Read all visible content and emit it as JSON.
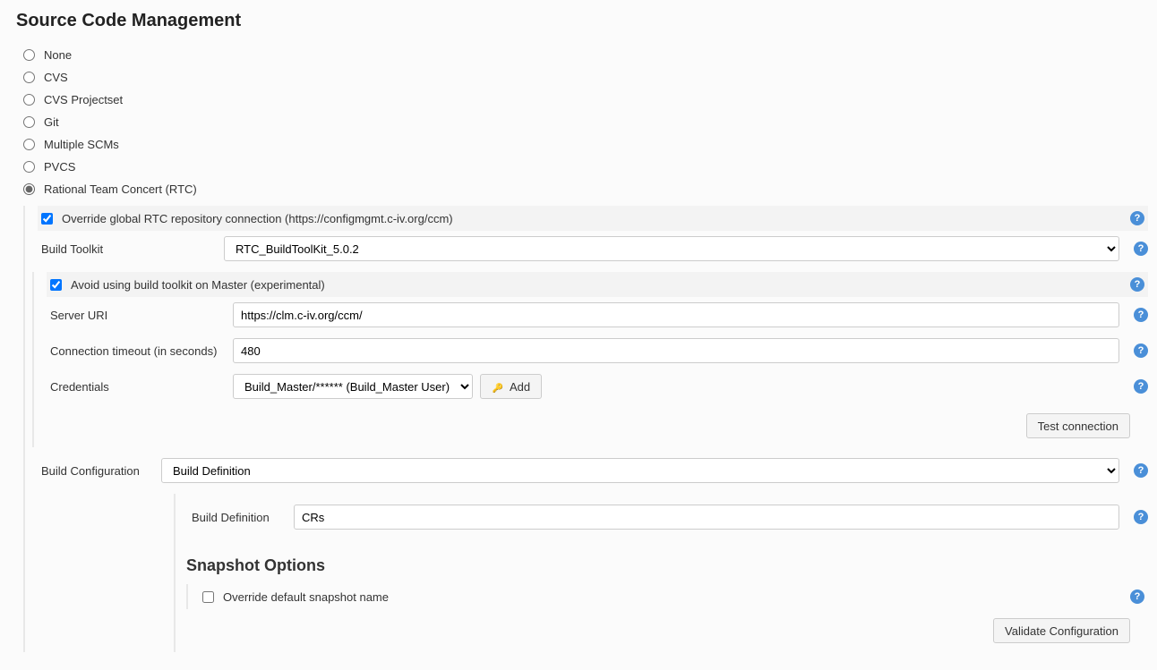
{
  "title": "Source Code Management",
  "scm_options": [
    {
      "label": "None",
      "selected": false
    },
    {
      "label": "CVS",
      "selected": false
    },
    {
      "label": "CVS Projectset",
      "selected": false
    },
    {
      "label": "Git",
      "selected": false
    },
    {
      "label": "Multiple SCMs",
      "selected": false
    },
    {
      "label": "PVCS",
      "selected": false
    },
    {
      "label": "Rational Team Concert (RTC)",
      "selected": true
    }
  ],
  "rtc": {
    "override_label": "Override global RTC repository connection (https://configmgmt.c-iv.org/ccm)",
    "override_checked": true,
    "build_toolkit_label": "Build Toolkit",
    "build_toolkit_value": "RTC_BuildToolKit_5.0.2",
    "avoid_toolkit_label": "Avoid using build toolkit on Master (experimental)",
    "avoid_toolkit_checked": true,
    "server_uri_label": "Server URI",
    "server_uri_value": "https://clm.c-iv.org/ccm/",
    "timeout_label": "Connection timeout (in seconds)",
    "timeout_value": "480",
    "credentials_label": "Credentials",
    "credentials_value": "Build_Master/****** (Build_Master User)",
    "add_button_label": "Add",
    "test_connection_label": "Test connection",
    "build_config_label": "Build Configuration",
    "build_config_value": "Build Definition",
    "build_definition_label": "Build Definition",
    "build_definition_value": "CRs",
    "snapshot_title": "Snapshot Options",
    "override_snapshot_label": "Override default snapshot name",
    "override_snapshot_checked": false,
    "validate_button_label": "Validate Configuration",
    "help_glyph": "?"
  }
}
